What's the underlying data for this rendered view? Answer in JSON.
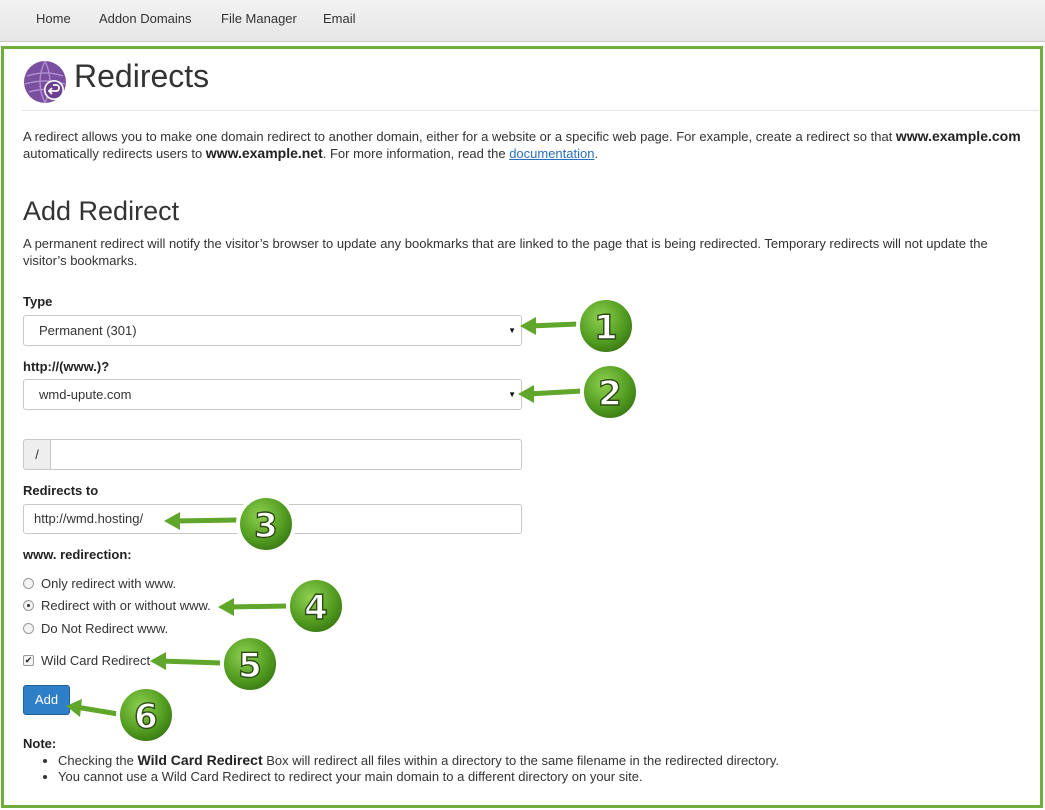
{
  "nav": {
    "items": [
      "Home",
      "Addon Domains",
      "File Manager",
      "Email"
    ]
  },
  "page": {
    "title": "Redirects",
    "intro_part1": "A redirect allows you to make one domain redirect to another domain, either for a website or a specific web page. For example, create a redirect so that ",
    "intro_bold1": "www.example.com",
    "intro_part2": " automatically redirects users to ",
    "intro_bold2": "www.example.net",
    "intro_part3": ". For more information, read the ",
    "intro_link": "documentation",
    "intro_part4": "."
  },
  "form": {
    "heading": "Add Redirect",
    "description": "A permanent redirect will notify the visitor’s browser to update any bookmarks that are linked to the page that is being redirected. Temporary redirects will not update the visitor’s bookmarks.",
    "type_label": "Type",
    "type_value": "Permanent (301)",
    "domain_label": "http://(www.)?",
    "domain_value": "wmd-upute.com",
    "path_prefix": "/",
    "path_value": "",
    "redirects_to_label": "Redirects to",
    "redirects_to_value": "http://wmd.hosting/",
    "www_label": "www. redirection:",
    "www_options": [
      {
        "label": "Only redirect with www.",
        "checked": false
      },
      {
        "label": "Redirect with or without www.",
        "checked": true
      },
      {
        "label": "Do Not Redirect www.",
        "checked": false
      }
    ],
    "wildcard_label": "Wild Card Redirect",
    "wildcard_checked": true,
    "add_button": "Add"
  },
  "note": {
    "label": "Note:",
    "item1_pre": "Checking the ",
    "item1_bold": "Wild Card Redirect",
    "item1_post": " Box will redirect all files within a directory to the same filename in the redirected directory.",
    "item2": "You cannot use a Wild Card Redirect to redirect your main domain to a different directory on your site."
  },
  "callouts": [
    "1",
    "2",
    "3",
    "4",
    "5",
    "6"
  ],
  "colors": {
    "frame_green": "#6fae3d",
    "badge_green": "#5fa62b",
    "button_blue": "#2f7ec8",
    "link_blue": "#2a6fbf",
    "logo_purple": "#7b4fa0"
  }
}
